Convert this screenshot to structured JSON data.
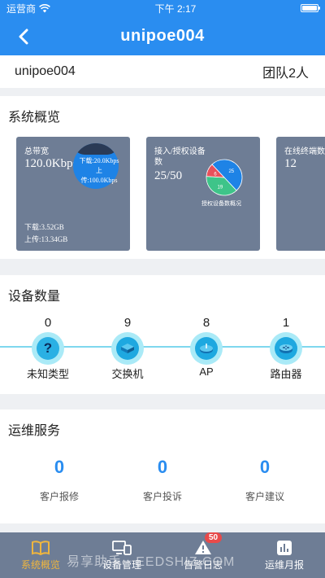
{
  "status_bar": {
    "carrier": "运营商",
    "time": "下午 2:17"
  },
  "nav": {
    "title": "unipoe004"
  },
  "account": {
    "name": "unipoe004",
    "team": "团队2人"
  },
  "overview": {
    "title": "系统概览",
    "bandwidth": {
      "label": "总带宽",
      "value": "120.0Kbps",
      "circle_line1": "下载:20.0Kbps",
      "circle_line2": "上",
      "circle_line3": "传:100.0Kbps",
      "download": "下载:3.52GB",
      "upload": "上传:13.34GB"
    },
    "devices": {
      "label_line1": "接入/授权设备",
      "label_line2": "数",
      "value": "25/50",
      "pie_caption": "授权设备数概况",
      "pie": [
        {
          "value": 25,
          "label": "25",
          "color": "#1e83e6"
        },
        {
          "value": 19,
          "label": "19",
          "color": "#3ec489"
        },
        {
          "value": 6,
          "label": "6",
          "color": "#e8505b"
        }
      ]
    },
    "online": {
      "label": "在线终端数",
      "value": "12"
    }
  },
  "device_count": {
    "title": "设备数量",
    "items": [
      {
        "count": "0",
        "name": "未知类型",
        "icon": "question-icon"
      },
      {
        "count": "9",
        "name": "交换机",
        "icon": "switch-icon"
      },
      {
        "count": "8",
        "name": "AP",
        "icon": "ap-icon"
      },
      {
        "count": "1",
        "name": "路由器",
        "icon": "router-icon"
      }
    ]
  },
  "service": {
    "title": "运维服务",
    "items": [
      {
        "value": "0",
        "label": "客户报修"
      },
      {
        "value": "0",
        "label": "客户投诉"
      },
      {
        "value": "0",
        "label": "客户建议"
      }
    ]
  },
  "tabs": [
    {
      "label": "系统概览",
      "icon": "book-icon",
      "active": true
    },
    {
      "label": "设备管理",
      "icon": "devices-icon"
    },
    {
      "label": "告警日志",
      "icon": "alert-icon",
      "badge": "50"
    },
    {
      "label": "运维月报",
      "icon": "chart-icon"
    }
  ],
  "watermark": "易享助手 · EEDSHIZ.COM",
  "colors": {
    "primary": "#2a8df0",
    "tab_active": "#f0b63d",
    "card": "#6e7d95"
  }
}
